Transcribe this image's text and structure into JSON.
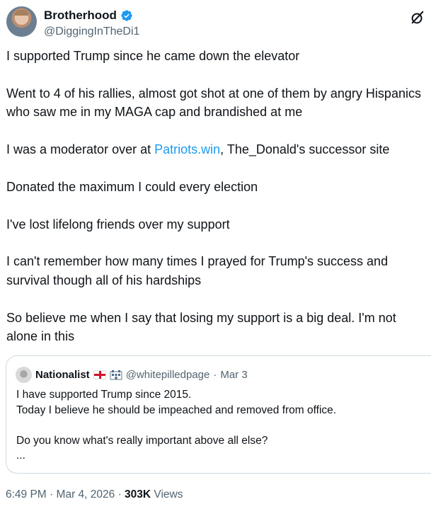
{
  "author": {
    "display_name": "Brotherhood",
    "handle": "@DiggingInTheDi1"
  },
  "post": {
    "paragraphs": [
      "I supported Trump since he came down the elevator",
      "Went to 4 of his rallies, almost got shot at one of them by angry Hispanics who saw me in my MAGA cap and brandished at me",
      "I've lost lifelong friends over my support",
      "I can't remember how many times I prayed for Trump's success and survival though all of his hardships",
      "So believe me when I say that losing my support is a big deal. I'm not alone in this"
    ],
    "moderator_line": {
      "before": "I was a moderator over at ",
      "link": "Patriots.win",
      "after": ", The_Donald's successor site"
    },
    "donation_line": "Donated the maximum I could every election"
  },
  "quote": {
    "name": "Nationalist",
    "handle": "@whitepilledpage",
    "separator": "·",
    "date": "Mar 3",
    "lines": [
      "I have supported Trump since 2015.",
      "Today I believe he should be impeached and removed from office.",
      "Do you know what's really important above all else?",
      "..."
    ]
  },
  "footer": {
    "time": "6:49 PM",
    "separator": "·",
    "date": "Mar 4, 2026",
    "views_count": "303K",
    "views_label": "Views"
  },
  "colors": {
    "link": "#1d9bf0",
    "secondary_text": "#536471",
    "primary_text": "#0f1419",
    "border": "#cfd9de"
  },
  "icons": [
    "verified-badge-icon",
    "grok-icon",
    "england-flag-icon",
    "building-icon"
  ]
}
